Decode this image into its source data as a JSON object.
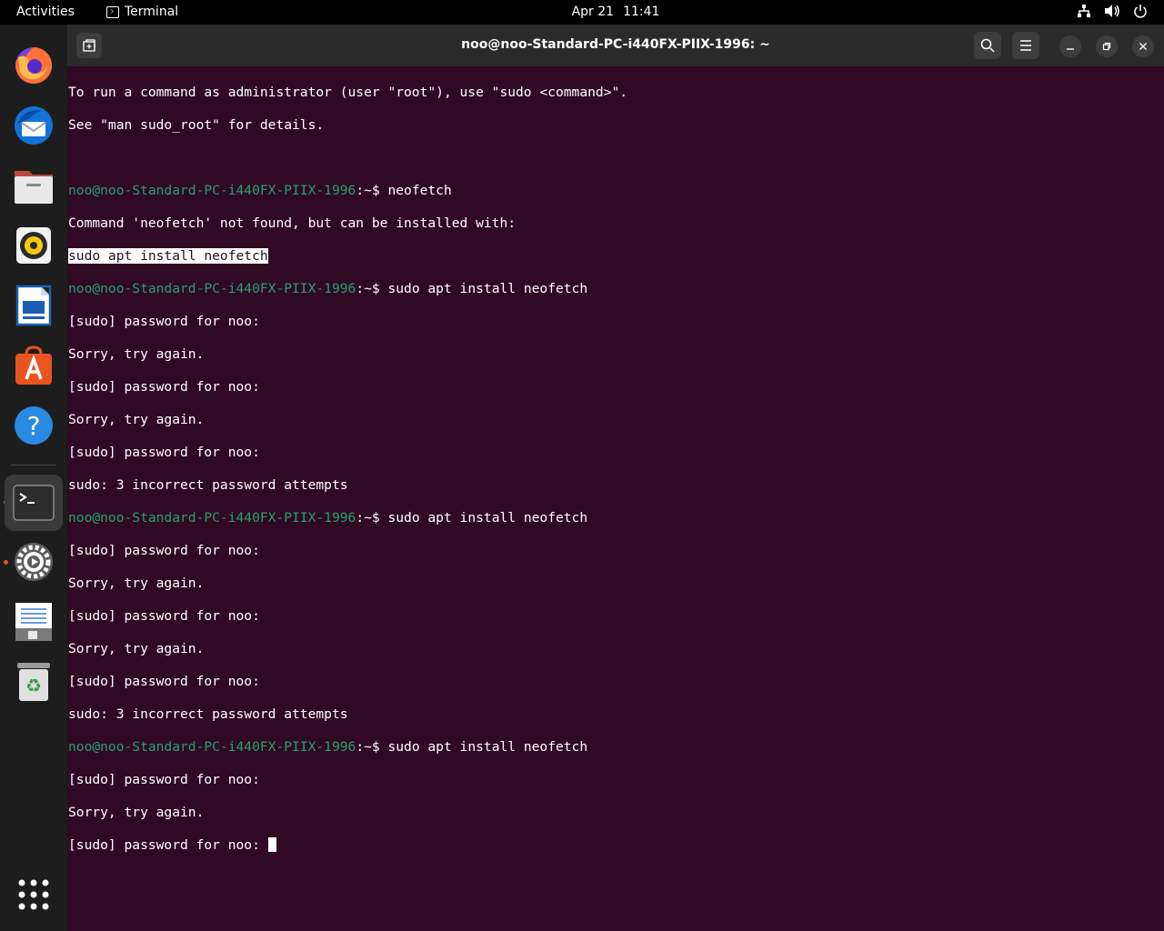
{
  "topbar": {
    "activities": "Activities",
    "app_name": "Terminal",
    "date": "Apr 21",
    "time": "11:41",
    "tray_icons": [
      "network-icon",
      "volume-icon",
      "power-icon"
    ]
  },
  "dock": {
    "items": [
      {
        "name": "firefox",
        "icon": "firefox-icon"
      },
      {
        "name": "thunderbird",
        "icon": "thunderbird-icon"
      },
      {
        "name": "files",
        "icon": "files-icon"
      },
      {
        "name": "rhythmbox",
        "icon": "rhythmbox-icon"
      },
      {
        "name": "libreoffice-writer",
        "icon": "writer-icon"
      },
      {
        "name": "software",
        "icon": "software-icon"
      },
      {
        "name": "help",
        "icon": "help-icon"
      },
      {
        "name": "terminal",
        "icon": "terminal-icon"
      },
      {
        "name": "settings",
        "icon": "settings-icon"
      },
      {
        "name": "text-editor",
        "icon": "text-editor-icon"
      },
      {
        "name": "trash",
        "icon": "trash-icon"
      },
      {
        "name": "show-apps",
        "icon": "app-grid-icon"
      }
    ]
  },
  "window": {
    "title": "noo@noo-Standard-PC-i440FX-PIIX-1996: ~"
  },
  "terminal": {
    "prompt_user": "noo@noo-Standard-PC-i440FX-PIIX-1996",
    "prompt_sep": ":~$ ",
    "lines": {
      "l1": "To run a command as administrator (user \"root\"), use \"sudo <command>\".",
      "l2": "See \"man sudo_root\" for details.",
      "cmd1": "neofetch",
      "l4": "Command 'neofetch' not found, but can be installed with:",
      "l5": "sudo apt install neofetch",
      "cmd2": "sudo apt install neofetch",
      "l7": "[sudo] password for noo:",
      "l8": "Sorry, try again.",
      "l9": "[sudo] password for noo:",
      "l10": "Sorry, try again.",
      "l11": "[sudo] password for noo:",
      "l12": "sudo: 3 incorrect password attempts",
      "cmd3": "sudo apt install neofetch",
      "l14": "[sudo] password for noo:",
      "l15": "Sorry, try again.",
      "l16": "[sudo] password for noo:",
      "l17": "Sorry, try again.",
      "l18": "[sudo] password for noo:",
      "l19": "sudo: 3 incorrect password attempts",
      "cmd4": "sudo apt install neofetch",
      "l21": "[sudo] password for noo:",
      "l22": "Sorry, try again.",
      "l23": "[sudo] password for noo: "
    }
  },
  "colors": {
    "terminal_bg": "#300a24",
    "prompt_user": "#26a269",
    "accent": "#e95420"
  }
}
